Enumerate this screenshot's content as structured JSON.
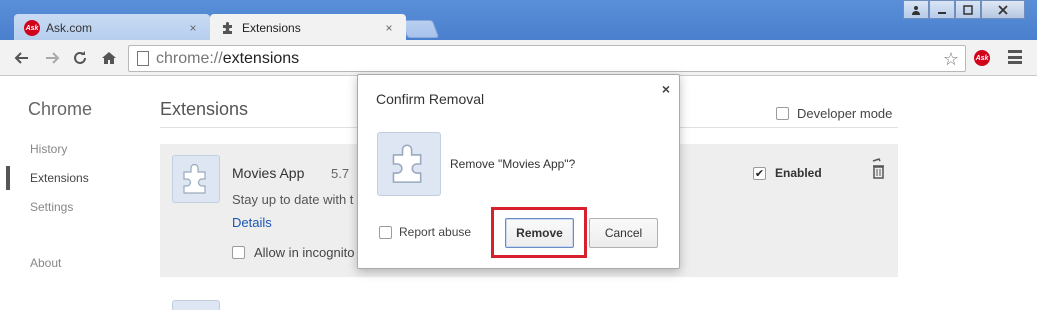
{
  "browser": {
    "tabs": [
      {
        "label": "Ask.com",
        "favicon": "ask-icon",
        "active": false
      },
      {
        "label": "Extensions",
        "favicon": "puzzle-icon",
        "active": true
      }
    ],
    "tab_close_glyph": "×",
    "url_scheme": "chrome://",
    "url_host": "extensions",
    "ask_badge": "Ask"
  },
  "sidebar": {
    "title": "Chrome",
    "items": [
      {
        "label": "History"
      },
      {
        "label": "Extensions",
        "active": true
      },
      {
        "label": "Settings"
      },
      {
        "label": "About"
      }
    ]
  },
  "main": {
    "title": "Extensions",
    "developer_mode_label": "Developer mode",
    "extension": {
      "name": "Movies App",
      "version": "5.7",
      "description": "Stay up to date with t",
      "details_link": "Details",
      "incognito_label": "Allow in incognito",
      "enabled_label": "Enabled",
      "enabled": true
    }
  },
  "dialog": {
    "title": "Confirm Removal",
    "close_glyph": "×",
    "message": "Remove \"Movies App\"?",
    "report_abuse_label": "Report abuse",
    "remove_label": "Remove",
    "cancel_label": "Cancel"
  },
  "colors": {
    "highlight": "#d8202d",
    "link": "#1a55b5",
    "frame": "#4a7fce"
  }
}
